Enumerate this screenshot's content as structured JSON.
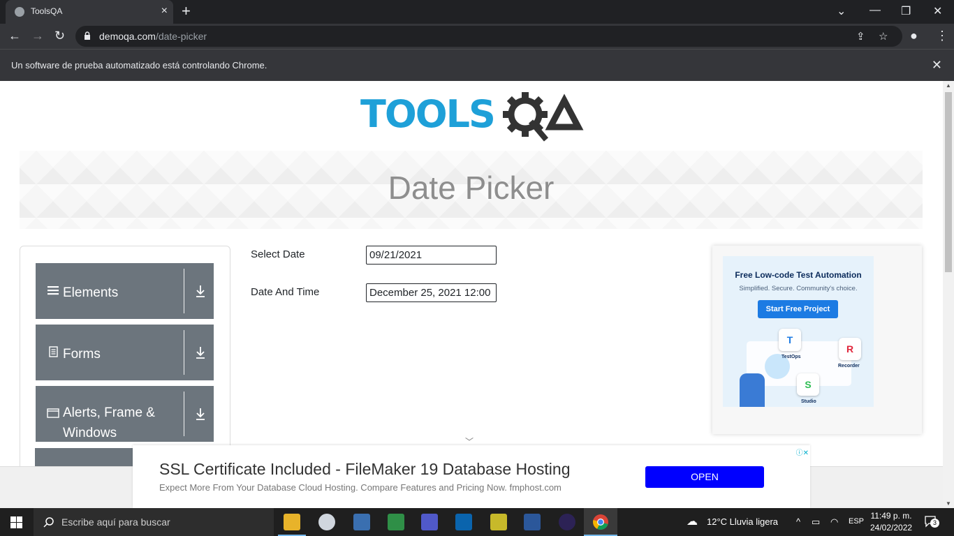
{
  "browser": {
    "tab_title": "ToolsQA",
    "url_domain": "demoqa.com",
    "url_path": "/date-picker",
    "infobar_text": "Un software de prueba automatizado está controlando Chrome."
  },
  "page": {
    "heading": "Date Picker",
    "sidebar": [
      {
        "label": "Elements"
      },
      {
        "label": "Forms"
      },
      {
        "label": "Alerts, Frame & Windows"
      }
    ],
    "select_date": {
      "label": "Select Date",
      "value": "09/21/2021"
    },
    "date_and_time": {
      "label": "Date And Time",
      "value": "December 25, 2021 12:00"
    }
  },
  "side_ad": {
    "title": "Free Low-code Test Automation",
    "subtitle": "Simplified. Secure. Community's choice.",
    "button": "Start Free Project",
    "apps": [
      "TestOps",
      "Recorder",
      "Studio"
    ]
  },
  "bottom_ad": {
    "headline": "SSL Certificate Included - FileMaker 19 Database Hosting",
    "subline": "Expect More From Your Database Cloud Hosting. Compare Features and Pricing Now. fmphost.com",
    "button": "OPEN"
  },
  "taskbar": {
    "search_placeholder": "Escribe aquí para buscar",
    "weather": "12°C  Lluvia ligera",
    "language": "ESP",
    "time": "11:49 p. m.",
    "date": "24/02/2022",
    "notifications": "3"
  },
  "colors": {
    "accent": "#1ea0d8",
    "sidebar_bg": "#6c757d",
    "ad_button": "#0000ff"
  }
}
